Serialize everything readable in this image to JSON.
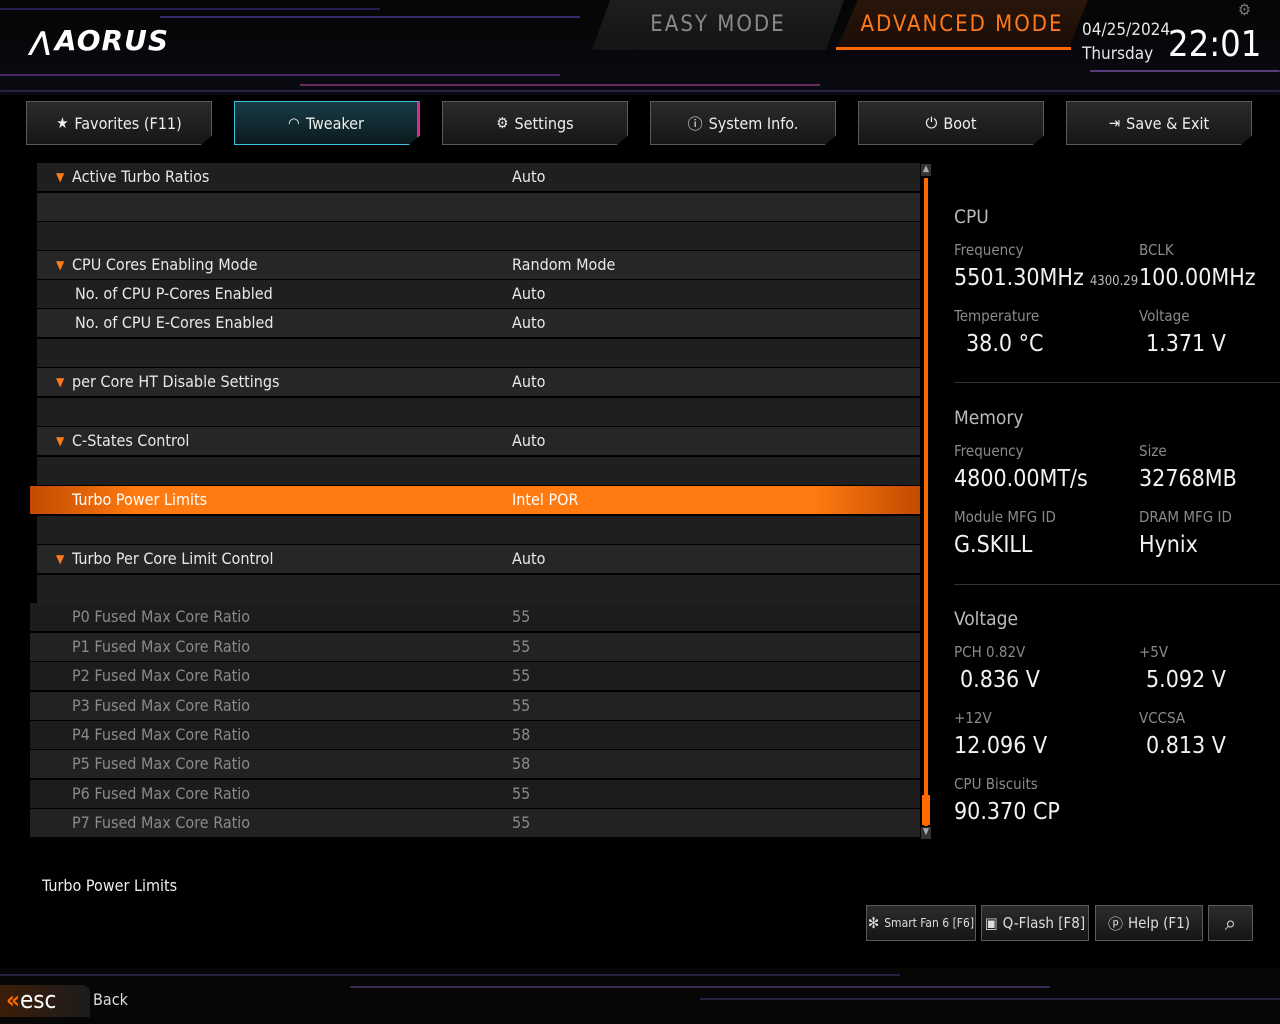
{
  "header": {
    "logo": "AORUS",
    "easy_mode": "EASY MODE",
    "advanced_mode": "ADVANCED MODE",
    "date": "04/25/2024",
    "day": "Thursday",
    "time": "22:01"
  },
  "tabs": [
    {
      "label": "Favorites (F11)",
      "icon": "star-folder-icon"
    },
    {
      "label": "Tweaker",
      "icon": "speedometer-icon",
      "active": true
    },
    {
      "label": "Settings",
      "icon": "gear-icon"
    },
    {
      "label": "System Info.",
      "icon": "info-icon"
    },
    {
      "label": "Boot",
      "icon": "power-icon"
    },
    {
      "label": "Save & Exit",
      "icon": "exit-icon"
    }
  ],
  "settings": [
    {
      "label": "Active Turbo Ratios",
      "value": "Auto",
      "expand": true
    },
    {
      "label": "",
      "value": ""
    },
    {
      "label": "",
      "value": ""
    },
    {
      "label": "CPU Cores Enabling Mode",
      "value": "Random Mode",
      "expand": true
    },
    {
      "label": "No. of CPU P-Cores Enabled",
      "value": "Auto"
    },
    {
      "label": "No. of CPU E-Cores Enabled",
      "value": "Auto"
    },
    {
      "label": "",
      "value": ""
    },
    {
      "label": "per Core HT Disable Settings",
      "value": "Auto",
      "expand": true
    },
    {
      "label": "",
      "value": ""
    },
    {
      "label": "C-States Control",
      "value": "Auto",
      "expand": true
    },
    {
      "label": "",
      "value": ""
    },
    {
      "label": "Turbo Power Limits",
      "value": "Intel POR",
      "selected": true
    },
    {
      "label": "",
      "value": ""
    },
    {
      "label": "Turbo Per Core Limit Control",
      "value": "Auto",
      "expand": true
    },
    {
      "label": "",
      "value": ""
    }
  ],
  "fused_ratios": [
    {
      "label": "P0 Fused Max Core Ratio",
      "value": "55"
    },
    {
      "label": "P1 Fused Max Core Ratio",
      "value": "55"
    },
    {
      "label": "P2 Fused Max Core Ratio",
      "value": "55"
    },
    {
      "label": "P3 Fused Max Core Ratio",
      "value": "55"
    },
    {
      "label": "P4 Fused Max Core Ratio",
      "value": "58"
    },
    {
      "label": "P5 Fused Max Core Ratio",
      "value": "58"
    },
    {
      "label": "P6 Fused Max Core Ratio",
      "value": "55"
    },
    {
      "label": "P7 Fused Max Core Ratio",
      "value": "55"
    }
  ],
  "cpu": {
    "title": "CPU",
    "freq_label": "Frequency",
    "freq_value": "5501.30MHz",
    "freq_sub": "4300.29",
    "bclk_label": "BCLK",
    "bclk_value": "100.00MHz",
    "temp_label": "Temperature",
    "temp_value": "38.0 °C",
    "volt_label": "Voltage",
    "volt_value": "1.371 V"
  },
  "memory": {
    "title": "Memory",
    "freq_label": "Frequency",
    "freq_value": "4800.00MT/s",
    "size_label": "Size",
    "size_value": "32768MB",
    "module_label": "Module MFG ID",
    "module_value": "G.SKILL",
    "dram_label": "DRAM MFG ID",
    "dram_value": "Hynix"
  },
  "voltage": {
    "title": "Voltage",
    "pch_label": "PCH 0.82V",
    "pch_value": "0.836 V",
    "v5_label": "+5V",
    "v5_value": "5.092 V",
    "v12_label": "+12V",
    "v12_value": "12.096 V",
    "vccsa_label": "VCCSA",
    "vccsa_value": "0.813 V",
    "biscuits_label": "CPU Biscuits",
    "biscuits_value": "90.370 CP"
  },
  "footer": {
    "help_text": "Turbo Power Limits",
    "smart_fan": "Smart Fan 6 [F6]",
    "qflash": "Q-Flash [F8]",
    "help": "Help (F1)",
    "esc": "esc",
    "back": "Back"
  },
  "colors": {
    "accent": "#ff6a00",
    "tab_active": "#39c2d8",
    "tab_active_edge": "#e0288c"
  }
}
